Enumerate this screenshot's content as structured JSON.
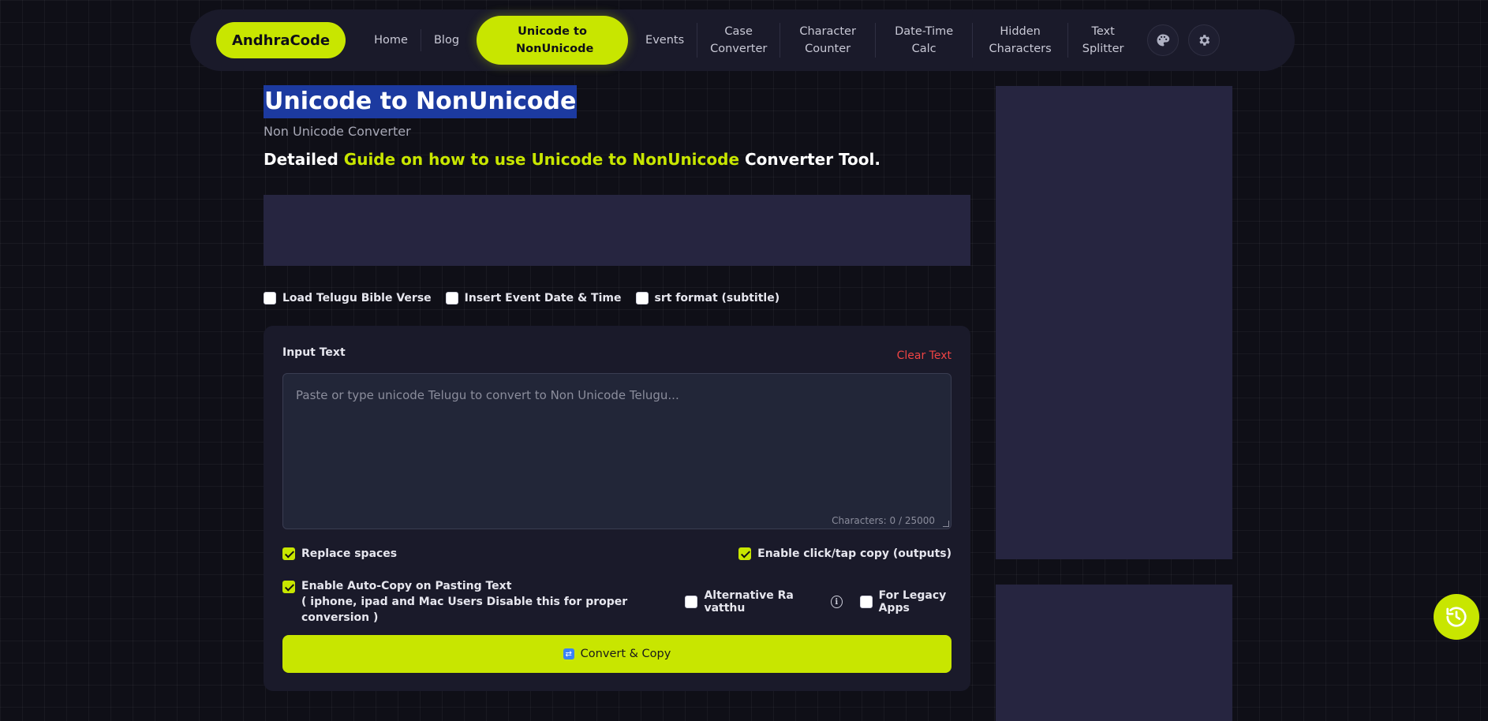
{
  "nav": {
    "brand": "AndhraCode",
    "items": [
      "Home",
      "Blog"
    ],
    "active": "Unicode to NonUnicode",
    "items_after": [
      "Events",
      "Case Converter",
      "Character Counter",
      "Date-Time Calc",
      "Hidden Characters",
      "Text Splitter"
    ],
    "icons": [
      "palette-icon",
      "gear-icon"
    ]
  },
  "header": {
    "title": "Unicode to NonUnicode",
    "subtitle": "Non Unicode Converter",
    "guide_prefix": "Detailed",
    "guide_link": "Guide on how to use Unicode to NonUnicode",
    "guide_suffix": "Converter Tool."
  },
  "options_top": [
    {
      "label": "Load Telugu Bible Verse",
      "checked": false
    },
    {
      "label": "Insert Event Date & Time",
      "checked": false
    },
    {
      "label": "srt format (subtitle)",
      "checked": false
    }
  ],
  "input": {
    "label": "Input Text",
    "clear_label": "Clear Text",
    "placeholder": "Paste or type unicode Telugu to convert to Non Unicode Telugu...",
    "char_count": "Characters: 0 / 25000"
  },
  "options": {
    "replace_spaces": {
      "label": "Replace spaces",
      "checked": true
    },
    "click_copy": {
      "label": "Enable click/tap copy (outputs)",
      "checked": true
    },
    "auto_copy": {
      "label": "Enable Auto-Copy on Pasting Text",
      "note": "( iphone, ipad and Mac Users Disable this for proper conversion )",
      "checked": true
    },
    "alt_ra": {
      "label": "Alternative Ra vatthu",
      "checked": false
    },
    "legacy": {
      "label": "For Legacy Apps",
      "checked": false
    }
  },
  "convert_button": "Convert & Copy",
  "colors": {
    "accent": "#c8e600",
    "background": "#0f0f17",
    "panel": "#1a1a2a",
    "danger": "#ef4444"
  }
}
